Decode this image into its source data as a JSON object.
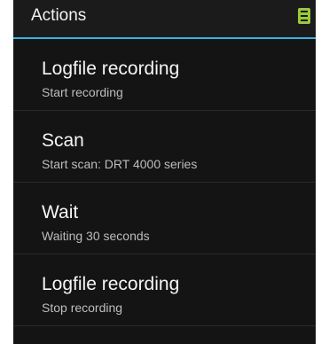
{
  "action_bar": {
    "title": "Actions",
    "overflow_icon": "menu-icon",
    "accent_color": "#33b5e5",
    "icon_color": "#98c93c"
  },
  "actions": [
    {
      "title": "Logfile recording",
      "subtitle": "Start recording"
    },
    {
      "title": "Scan",
      "subtitle": "Start scan: DRT 4000 series"
    },
    {
      "title": "Wait",
      "subtitle": "Waiting 30 seconds"
    },
    {
      "title": "Logfile recording",
      "subtitle": "Stop recording"
    }
  ]
}
